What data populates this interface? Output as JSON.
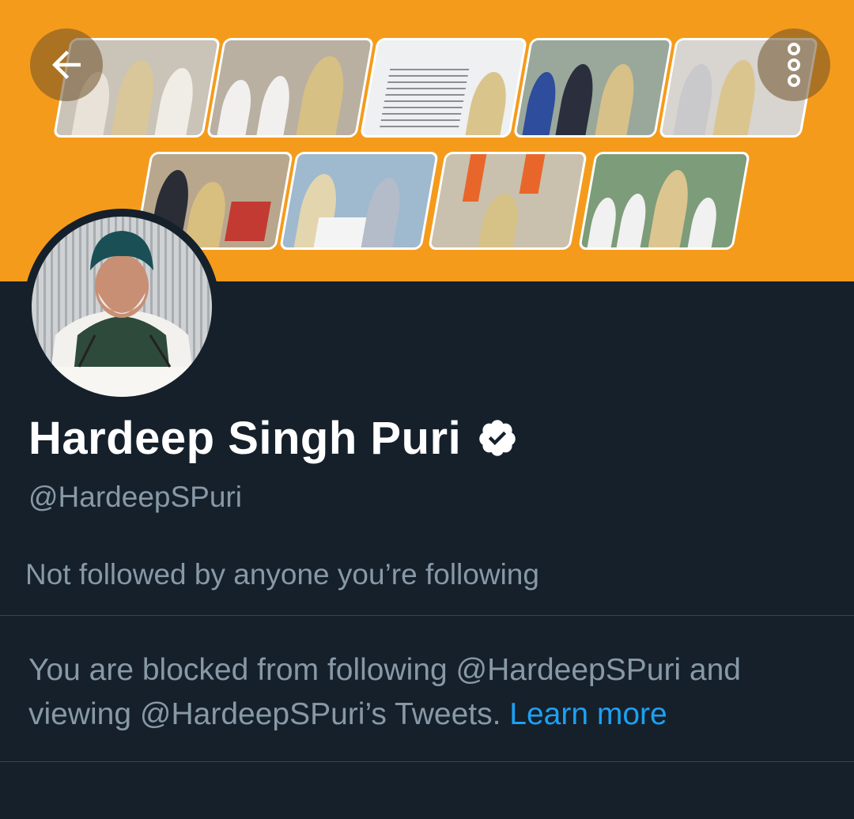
{
  "header": {
    "back_icon": "back-arrow-icon",
    "more_icon": "more-vertical-icon",
    "banner_colors": {
      "background": "#f59b1c"
    }
  },
  "profile": {
    "name": "Hardeep Singh Puri",
    "verified_icon": "verified-badge-icon",
    "handle": "@HardeepSPuri",
    "followers_you_know": "Not followed by anyone you’re following"
  },
  "blocked_notice": {
    "text": "You are blocked from following @HardeepSPuri and viewing @HardeepSPuri’s Tweets.",
    "link_label": "Learn more",
    "link_color": "#1da1f2"
  },
  "colors": {
    "page_background": "#15202b",
    "primary_text": "#ffffff",
    "secondary_text": "#8899a6",
    "divider": "#38444d"
  }
}
